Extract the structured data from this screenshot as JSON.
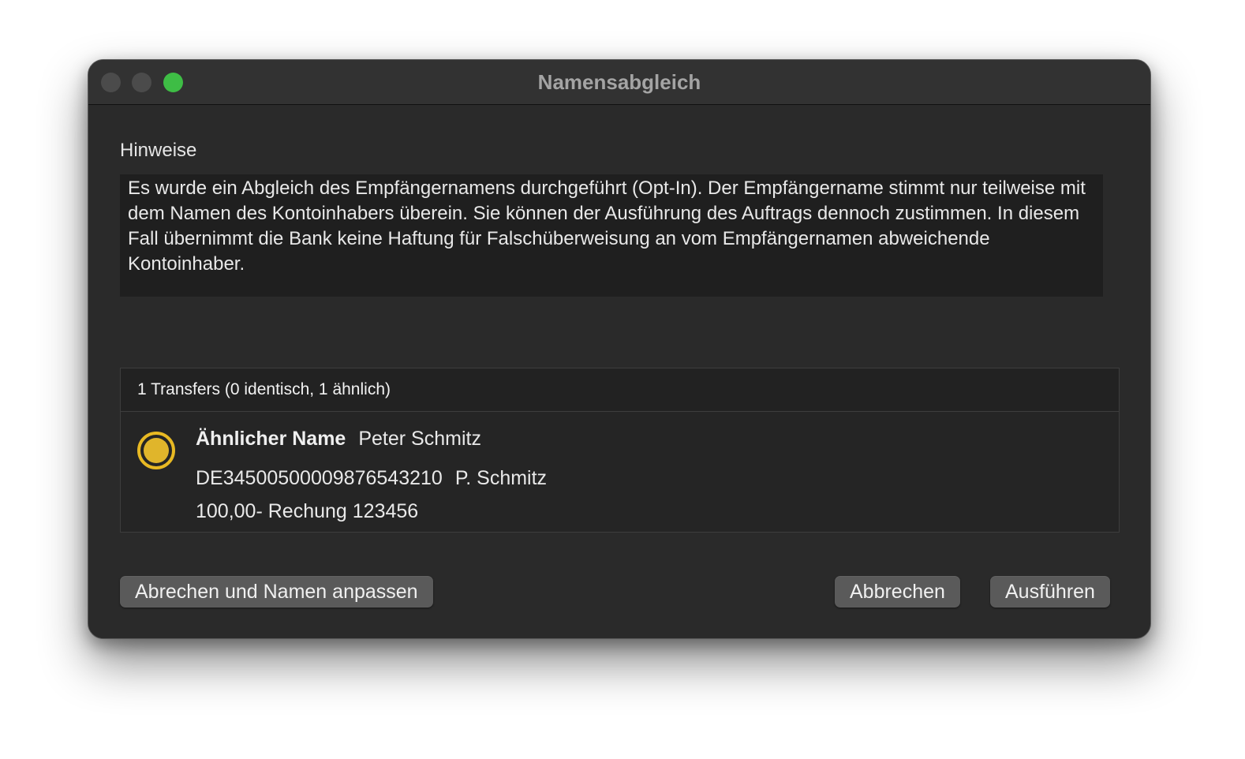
{
  "window": {
    "title": "Namensabgleich"
  },
  "hints": {
    "label": "Hinweise",
    "text": "Es wurde ein Abgleich des Empfängernamens durchgeführt (Opt-In). Der Empfängername stimmt nur teilweise mit dem Namen des Kontoinhabers überein. Sie können der Ausführung des Auftrags dennoch zustimmen. In diesem Fall übernimmt die Bank keine Haftung für Falschüberweisung an vom Empfängernamen abweichende Kontoinhaber."
  },
  "transfers": {
    "summary": "1 Transfers (0 identisch, 1 ähnlich)",
    "items": [
      {
        "status_icon": "yellow-circle-icon",
        "status_color": "#e8b923",
        "match_label": "Ähnlicher Name",
        "matched_name": "Peter Schmitz",
        "iban": "DE34500500009876543210",
        "entered_name": "P. Schmitz",
        "amount": "100,00-",
        "purpose": "Rechung 123456"
      }
    ]
  },
  "buttons": {
    "adjust_label": "Abrechen und Namen anpassen",
    "cancel_label": "Abbrechen",
    "execute_label": "Ausführen"
  },
  "colors": {
    "traffic_close": "#4b4b4b",
    "traffic_minimize": "#4b4b4b",
    "traffic_zoom": "#3ebd45"
  }
}
